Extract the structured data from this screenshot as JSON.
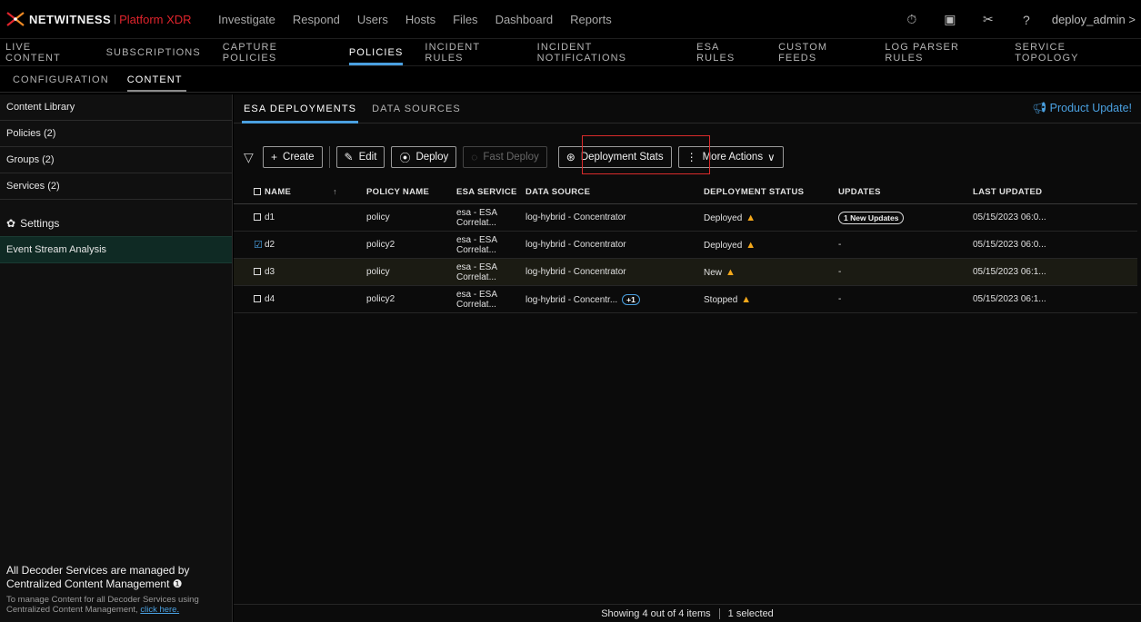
{
  "brand": {
    "name": "NETWITNESS",
    "separator": "|",
    "product": "Platform XDR",
    "accent": "#e0242c"
  },
  "top_nav": [
    "Investigate",
    "Respond",
    "Users",
    "Hosts",
    "Files",
    "Dashboard",
    "Reports"
  ],
  "top_right": {
    "icons": [
      "timer-icon",
      "admin-panel-icon",
      "tools-icon",
      "help-icon"
    ],
    "user": "deploy_admin >"
  },
  "main_nav": {
    "items": [
      "LIVE CONTENT",
      "SUBSCRIPTIONS",
      "CAPTURE POLICIES",
      "POLICIES",
      "INCIDENT RULES",
      "INCIDENT NOTIFICATIONS",
      "ESA RULES",
      "CUSTOM FEEDS",
      "LOG PARSER RULES",
      "SERVICE TOPOLOGY"
    ],
    "active": "POLICIES"
  },
  "sub_nav": {
    "items": [
      "CONFIGURATION",
      "CONTENT"
    ],
    "active": "CONTENT"
  },
  "sidebar": {
    "items": [
      "Content Library",
      "Policies (2)",
      "Groups (2)",
      "Services (2)"
    ],
    "settings_label": "Settings",
    "esa_label": "Event Stream Analysis",
    "footer_title": "All Decoder Services are managed by Centralized Content Management",
    "footer_text": "To manage Content for all Decoder Services using Centralized Content Management,",
    "footer_link": "click here."
  },
  "content_tabs": {
    "items": [
      "ESA DEPLOYMENTS",
      "DATA SOURCES"
    ],
    "active": "ESA DEPLOYMENTS"
  },
  "product_update": "Product Update!",
  "toolbar": {
    "create": "Create",
    "edit": "Edit",
    "deploy": "Deploy",
    "fast_deploy": "Fast Deploy",
    "deployment_stats": "Deployment Stats",
    "more_actions": "More Actions"
  },
  "table": {
    "headers": [
      "NAME",
      "POLICY NAME",
      "ESA SERVICE",
      "DATA SOURCE",
      "DEPLOYMENT STATUS",
      "UPDATES",
      "LAST UPDATED"
    ],
    "rows": [
      {
        "checked": false,
        "name": "d1",
        "policy": "policy",
        "esa": "esa - ESA Correlat...",
        "source": "log-hybrid - Concentrator",
        "status": "Deployed",
        "updates": "1 New Updates",
        "last": "05/15/2023 06:0..."
      },
      {
        "checked": true,
        "name": "d2",
        "policy": "policy2",
        "esa": "esa - ESA Correlat...",
        "source": "log-hybrid - Concentrator",
        "status": "Deployed",
        "updates": "-",
        "last": "05/15/2023 06:0..."
      },
      {
        "checked": false,
        "name": "d3",
        "policy": "policy",
        "esa": "esa - ESA Correlat...",
        "source": "log-hybrid - Concentrator",
        "status": "New",
        "updates": "-",
        "last": "05/15/2023 06:1..."
      },
      {
        "checked": false,
        "name": "d4",
        "policy": "policy2",
        "esa": "esa - ESA Correlat...",
        "source": "log-hybrid - Concentr...",
        "source_extra": "+1",
        "status": "Stopped",
        "updates": "-",
        "last": "05/15/2023 06:1..."
      }
    ]
  },
  "footer": {
    "showing": "Showing 4 out of 4 items",
    "selected": "1 selected"
  }
}
